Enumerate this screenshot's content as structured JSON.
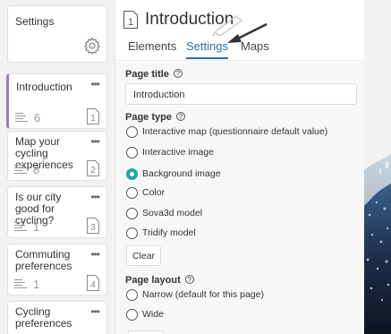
{
  "sidebar": {
    "settings_card": {
      "title": "Settings",
      "icon": "gear-icon"
    },
    "pages": [
      {
        "title": "Introduction",
        "count": "6",
        "number": "1",
        "active": true
      },
      {
        "title": "Map your cycling experiences",
        "count": "8",
        "number": "2"
      },
      {
        "title": "Is our city good for cycling?",
        "count": "1",
        "number": "3"
      },
      {
        "title": "Commuting preferences",
        "count": "1",
        "number": "4"
      },
      {
        "title": "Cycling preferences",
        "count": "",
        "number": ""
      }
    ],
    "more_icon_text": "•••"
  },
  "header": {
    "page_number": "1",
    "title": "Introduction",
    "tabs": [
      "Elements",
      "Settings",
      "Maps"
    ],
    "active_tab": "Settings"
  },
  "form": {
    "page_title_label": "Page title",
    "page_title_value": "Introduction",
    "page_type_label": "Page type",
    "page_type_options": [
      "Interactive map  (questionnaire default value)",
      "Interactive image",
      "Background image",
      "Color",
      "Sova3d model",
      "Tridify model"
    ],
    "page_type_selected": "Background image",
    "clear_label": "Clear",
    "page_layout_label": "Page layout",
    "page_layout_options": [
      "Narrow  (default for this page)",
      "Wide"
    ],
    "help_glyph": "?"
  },
  "colors": {
    "accent": "#2b6fa8",
    "radio_selected": "#1fa79a",
    "active_card_border": "#9b78c8"
  }
}
